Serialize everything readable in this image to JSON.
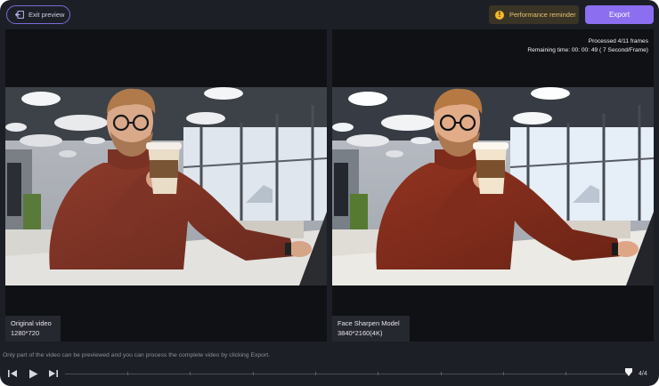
{
  "toolbar": {
    "exit_label": "Exit preview",
    "performance_label": "Performance reminder",
    "export_label": "Export"
  },
  "left_panel": {
    "title": "Original video",
    "resolution": "1280*720"
  },
  "right_panel": {
    "title": "Face Sharpen Model",
    "resolution": "3840*2160(4K)",
    "processed": "Processed 4/11 frames",
    "remaining": "Remaining time: 00: 00: 49 ( 7 Second/Frame)"
  },
  "footer": {
    "hint": "Only part of the video can be previewed and you can process the complete video by clicking Export.",
    "page_count": "4/4",
    "playhead_progress": 1.0
  },
  "colors": {
    "background": "#1d1f27",
    "accent": "#8b6ff0",
    "warning": "#f3b92a"
  }
}
